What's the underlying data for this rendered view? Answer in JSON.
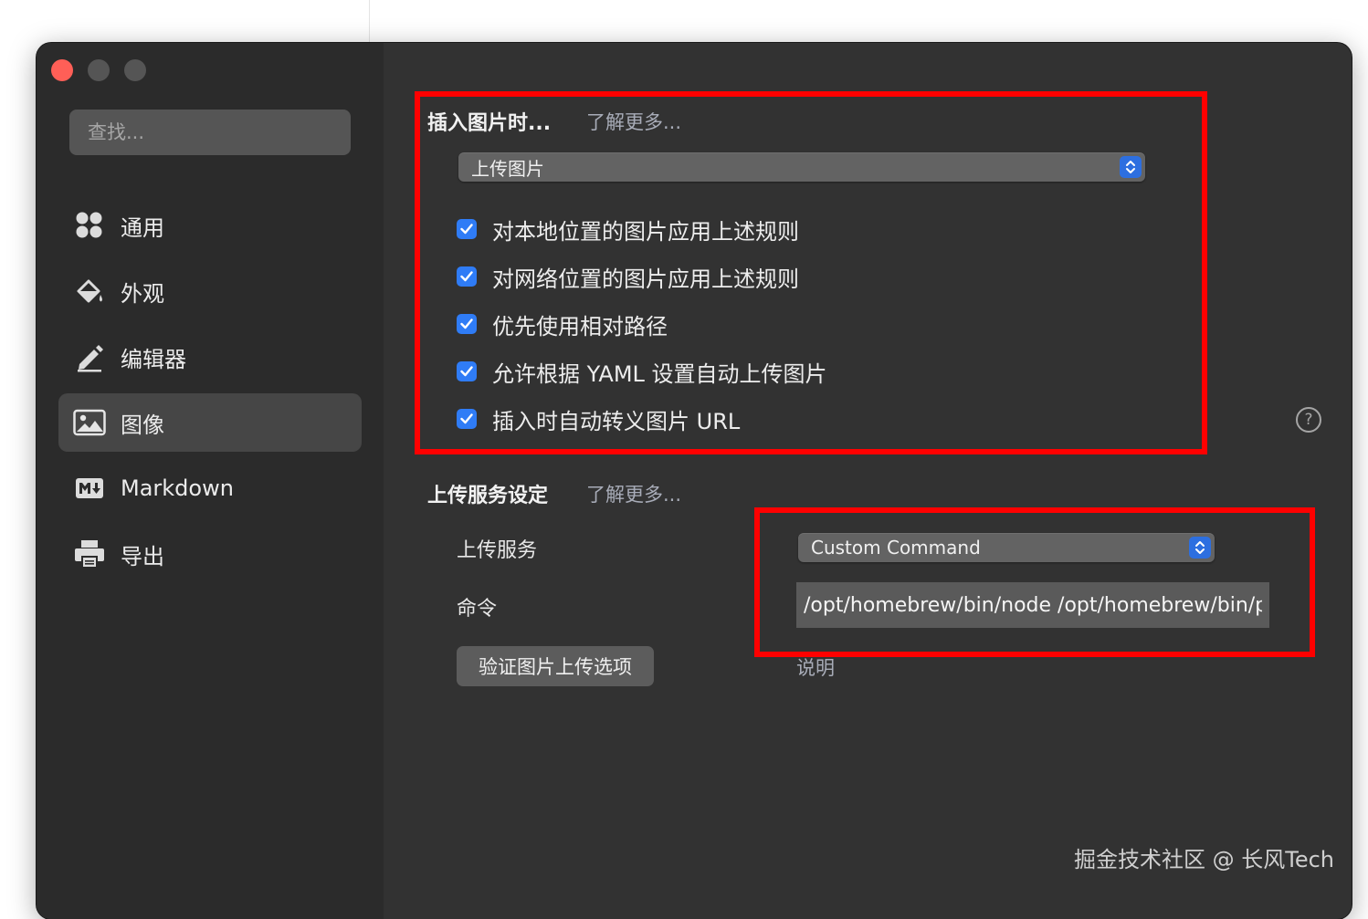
{
  "sidebar": {
    "search_placeholder": "查找...",
    "items": [
      {
        "label": "通用",
        "icon": "grid-icon"
      },
      {
        "label": "外观",
        "icon": "paint-bucket-icon"
      },
      {
        "label": "编辑器",
        "icon": "pencil-icon"
      },
      {
        "label": "图像",
        "icon": "image-icon",
        "active": true
      },
      {
        "label": "Markdown",
        "icon": "markdown-icon"
      },
      {
        "label": "导出",
        "icon": "printer-icon"
      }
    ]
  },
  "insert_image": {
    "title": "插入图片时...",
    "learn_more": "了解更多...",
    "action_select": "上传图片",
    "options": [
      {
        "label": "对本地位置的图片应用上述规则",
        "checked": true
      },
      {
        "label": "对网络位置的图片应用上述规则",
        "checked": true
      },
      {
        "label": "优先使用相对路径",
        "checked": true
      },
      {
        "label": "允许根据 YAML 设置自动上传图片",
        "checked": true
      },
      {
        "label": "插入时自动转义图片 URL",
        "checked": true
      }
    ]
  },
  "upload_service": {
    "title": "上传服务设定",
    "learn_more": "了解更多...",
    "service_label": "上传服务",
    "service_value": "Custom Command",
    "command_label": "命令",
    "command_value": "/opt/homebrew/bin/node /opt/homebrew/bin/picgo upload",
    "verify_button": "验证图片上传选项",
    "explain_link": "说明"
  },
  "help_symbol": "?",
  "watermark": "掘金技术社区 @ 长风Tech",
  "colors": {
    "window_bg": "#323232",
    "sidebar_bg": "#2b2b2b",
    "accent": "#2f7cf6",
    "annotation": "#ff0000"
  }
}
